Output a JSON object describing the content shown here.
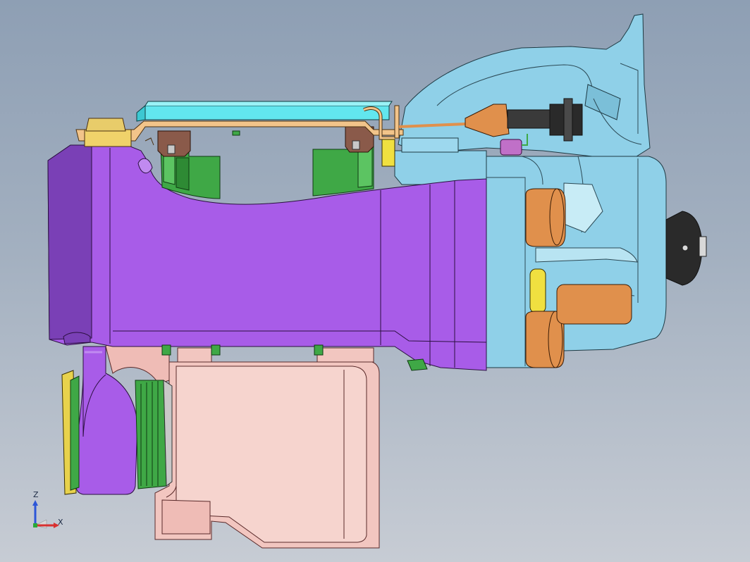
{
  "viewport": {
    "background_top": "#8e9fb4",
    "background_bottom": "#c7ccd4"
  },
  "model": {
    "parts": [
      {
        "name": "purple-main-bracket",
        "color": "#a85ce8"
      },
      {
        "name": "blue-housing",
        "color": "#8fd0e8"
      },
      {
        "name": "cyan-crossbar",
        "color": "#62e6ee"
      },
      {
        "name": "pink-bracket",
        "color": "#f2c6c0"
      },
      {
        "name": "green-clip",
        "color": "#3fa846"
      },
      {
        "name": "orange-bushing",
        "color": "#e0904c"
      },
      {
        "name": "yellow-pulley",
        "color": "#e8d24c"
      },
      {
        "name": "black-cap",
        "color": "#222222"
      },
      {
        "name": "brown-mount",
        "color": "#8a5a4a"
      }
    ]
  },
  "triad": {
    "z_label": "Z",
    "x_label": "X",
    "z_color": "#2d56d8",
    "x_color": "#d83030",
    "y_color": "#2aa838"
  }
}
